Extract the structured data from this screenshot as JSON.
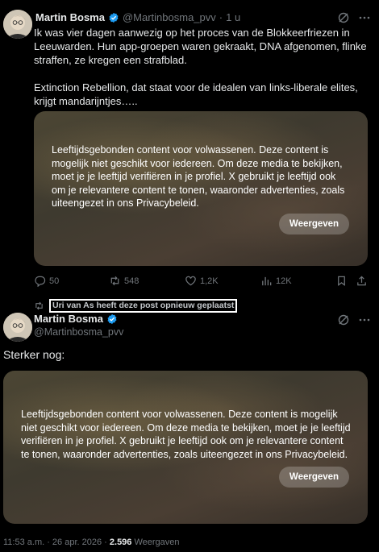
{
  "tweet1": {
    "author_name": "Martin Bosma",
    "author_handle": "@Martinbosma_pvv",
    "separator": "·",
    "time_ago": "1 u",
    "text_lines": [
      "Ik was vier dagen aanwezig op het proces van de Blokkeerfriezen in",
      "Leeuwarden. Hun app-groepen waren gekraakt, DNA afgenomen, flinke",
      "straffen, ze kregen een strafblad.",
      "",
      "Extinction Rebellion, dat staat voor de idealen van links-liberale elites,",
      "krijgt mandarijntjes….."
    ],
    "media_warning_lines": [
      "Leeftijdsgebonden content voor volwassenen. Deze content is",
      "mogelijk niet geschikt voor iedereen. Om deze media te bekijken,",
      "moet je je leeftijd verifiëren in je profiel. X gebruikt je leeftijd ook",
      "om je relevantere content te tonen, waaronder advertenties, zoals",
      "uiteengezet in ons Privacybeleid."
    ],
    "show_button": "Weergeven",
    "actions": {
      "replies": "50",
      "reposts": "548",
      "likes": "1,2K",
      "views": "12K"
    }
  },
  "repost_banner": "Uri van As heeft deze post opnieuw geplaatst",
  "tweet2": {
    "author_name": "Martin Bosma",
    "author_handle": "@Martinbosma_pvv",
    "text": "Sterker nog:",
    "media_warning_lines": [
      "Leeftijdsgebonden content voor volwassenen. Deze content is mogelijk",
      "niet geschikt voor iedereen. Om deze media te bekijken, moet je je leeftijd",
      "verifiëren in je profiel. X gebruikt je leeftijd ook om je relevantere content",
      "te tonen, waaronder advertenties, zoals uiteengezet in ons Privacybeleid."
    ],
    "show_button": "Weergeven",
    "timestamp": "11:53 a.m. · 26 apr. 2026 · ",
    "view_count": "2.596",
    "views_label": " Weergaven"
  },
  "colors": {
    "background": "#000000",
    "text": "#e7e9ea",
    "muted": "#71767b",
    "verified": "#1d9bf0"
  }
}
